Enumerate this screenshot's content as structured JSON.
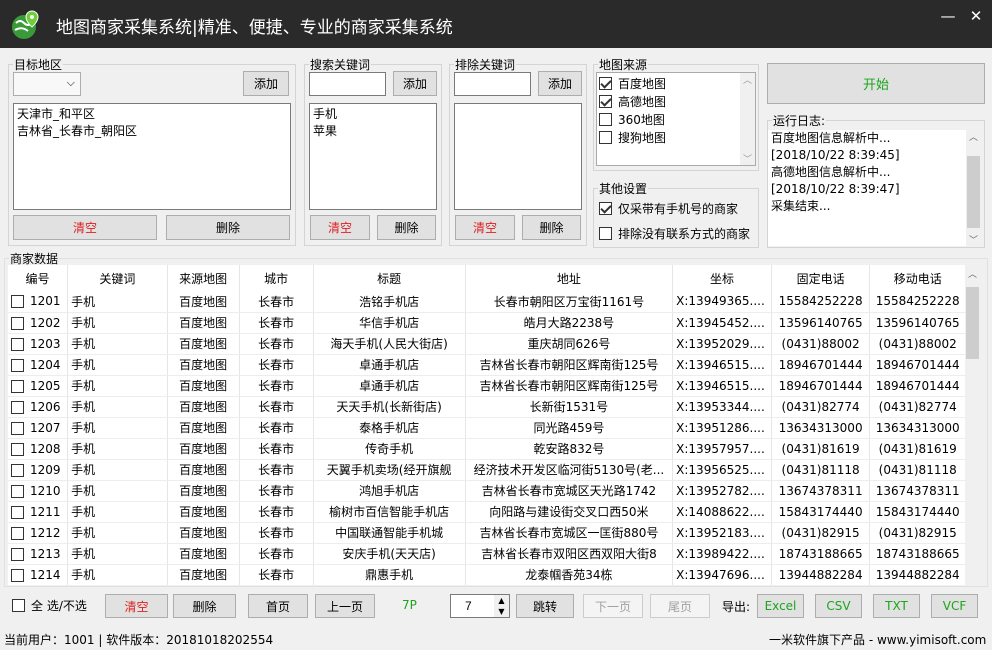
{
  "app": {
    "title": "地图商家采集系统|精准、便捷、专业的商家采集系统",
    "minimize": "—",
    "close": "✕",
    "logo_icon": "globe-pin-logo"
  },
  "region": {
    "legend": "目标地区",
    "add": "添加",
    "items": [
      "天津市_和平区",
      "吉林省_长春市_朝阳区"
    ],
    "clear": "清空",
    "delete": "删除"
  },
  "keywords": {
    "legend": "搜索关键词",
    "add": "添加",
    "input_value": "",
    "items": [
      "手机",
      "苹果"
    ],
    "clear": "清空",
    "delete": "删除"
  },
  "exclude": {
    "legend": "排除关键词",
    "add": "添加",
    "input_value": "",
    "items": [],
    "clear": "清空",
    "delete": "删除"
  },
  "sources": {
    "legend": "地图来源",
    "items": [
      {
        "label": "百度地图",
        "checked": true
      },
      {
        "label": "高德地图",
        "checked": true
      },
      {
        "label": "360地图",
        "checked": false
      },
      {
        "label": "搜狗地图",
        "checked": false
      }
    ]
  },
  "other": {
    "legend": "其他设置",
    "mobile_only": {
      "label": "仅采带有手机号的商家",
      "checked": true
    },
    "exclude_no_contact": {
      "label": "排除没有联系方式的商家",
      "checked": false
    }
  },
  "start": {
    "label": "开始"
  },
  "log": {
    "legend": "运行日志:",
    "lines": [
      "百度地图信息解析中...",
      "[2018/10/22 8:39:45]",
      "高德地图信息解析中...",
      "[2018/10/22 8:39:47]",
      "采集结束..."
    ]
  },
  "data": {
    "legend": "商家数据",
    "columns": [
      "编号",
      "关键词",
      "来源地图",
      "城市",
      "标题",
      "地址",
      "坐标",
      "固定电话",
      "移动电话"
    ],
    "rows": [
      [
        "1201",
        "手机",
        "百度地图",
        "长春市",
        "浩铭手机店",
        "长春市朝阳区万宝街1161号",
        "X:13949365....",
        "15584252228",
        "15584252228"
      ],
      [
        "1202",
        "手机",
        "百度地图",
        "长春市",
        "华信手机店",
        "皓月大路2238号",
        "X:13945452....",
        "13596140765",
        "13596140765"
      ],
      [
        "1203",
        "手机",
        "百度地图",
        "长春市",
        "海天手机(人民大街店)",
        "重庆胡同626号",
        "X:13952029....",
        "(0431)88002",
        "(0431)88002"
      ],
      [
        "1204",
        "手机",
        "百度地图",
        "长春市",
        "卓通手机店",
        "吉林省长春市朝阳区辉南街125号",
        "X:13946515....",
        "18946701444",
        "18946701444"
      ],
      [
        "1205",
        "手机",
        "百度地图",
        "长春市",
        "卓通手机店",
        "吉林省长春市朝阳区辉南街125号",
        "X:13946515....",
        "18946701444",
        "18946701444"
      ],
      [
        "1206",
        "手机",
        "百度地图",
        "长春市",
        "天天手机(长新街店)",
        "长新街1531号",
        "X:13953344....",
        "(0431)82774",
        "(0431)82774"
      ],
      [
        "1207",
        "手机",
        "百度地图",
        "长春市",
        "泰格手机店",
        "同光路459号",
        "X:13951286....",
        "13634313000",
        "13634313000"
      ],
      [
        "1208",
        "手机",
        "百度地图",
        "长春市",
        "传奇手机",
        "乾安路832号",
        "X:13957957....",
        "(0431)81619",
        "(0431)81619"
      ],
      [
        "1209",
        "手机",
        "百度地图",
        "长春市",
        "天翼手机卖场(经开旗舰",
        "经济技术开发区临河街5130号(老...",
        "X:13956525....",
        "(0431)81118",
        "(0431)81118"
      ],
      [
        "1210",
        "手机",
        "百度地图",
        "长春市",
        "鸿旭手机店",
        "吉林省长春市宽城区天光路1742",
        "X:13952782....",
        "13674378311",
        "13674378311"
      ],
      [
        "1211",
        "手机",
        "百度地图",
        "长春市",
        "榆树市百信智能手机店",
        "向阳路与建设街交叉口西50米",
        "X:14088622....",
        "15843174440",
        "15843174440"
      ],
      [
        "1212",
        "手机",
        "百度地图",
        "长春市",
        "中国联通智能手机城",
        "吉林省长春市宽城区一匡街880号",
        "X:13952183....",
        "(0431)82915",
        "(0431)82915"
      ],
      [
        "1213",
        "手机",
        "百度地图",
        "长春市",
        "安庆手机(天天店)",
        "吉林省长春市双阳区西双阳大街8",
        "X:13989422....",
        "18743188665",
        "18743188665"
      ],
      [
        "1214",
        "手机",
        "百度地图",
        "长春市",
        "鼎惠手机",
        "龙泰帼香苑34栋",
        "X:13947696....",
        "13944882284",
        "13944882284"
      ]
    ]
  },
  "footer": {
    "select_all": "全 选/不选",
    "clear": "清空",
    "delete": "删除",
    "first": "首页",
    "prev": "上一页",
    "page_count": "7P",
    "page_value": "7",
    "goto": "跳转",
    "next": "下一页",
    "last": "尾页",
    "export_label": "导出:",
    "export": [
      "Excel",
      "CSV",
      "TXT",
      "VCF"
    ]
  },
  "status": {
    "left": "当前用户：1001 | 软件版本：20181018202554",
    "right": "一米软件旗下产品 - www.yimisoft.com"
  },
  "colors": {
    "titlebar": "#2a2a2a",
    "red_text": "#e02020",
    "green_text": "#1aa51a"
  }
}
